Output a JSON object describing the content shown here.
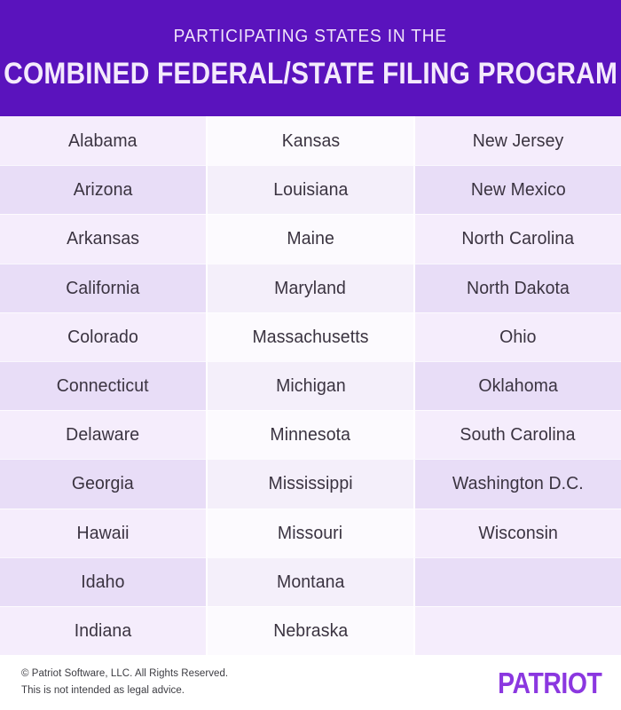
{
  "header": {
    "subtitle": "PARTICIPATING STATES IN THE",
    "title": "COMBINED FEDERAL/STATE FILING PROGRAM",
    "background_color": "#5A13BD",
    "text_color": "#F4EAFC"
  },
  "table": {
    "columns": 3,
    "rows": [
      {
        "col1": "Alabama",
        "col2": "Kansas",
        "col3": "New Jersey"
      },
      {
        "col1": "Arizona",
        "col2": "Louisiana",
        "col3": "New Mexico"
      },
      {
        "col1": "Arkansas",
        "col2": "Maine",
        "col3": "North Carolina"
      },
      {
        "col1": "California",
        "col2": "Maryland",
        "col3": "North Dakota"
      },
      {
        "col1": "Colorado",
        "col2": "Massachusetts",
        "col3": "Ohio"
      },
      {
        "col1": "Connecticut",
        "col2": "Michigan",
        "col3": "Oklahoma"
      },
      {
        "col1": "Delaware",
        "col2": "Minnesota",
        "col3": "South Carolina"
      },
      {
        "col1": "Georgia",
        "col2": "Mississippi",
        "col3": "Washington D.C."
      },
      {
        "col1": "Hawaii",
        "col2": "Missouri",
        "col3": "Wisconsin"
      },
      {
        "col1": "Idaho",
        "col2": "Montana",
        "col3": ""
      },
      {
        "col1": "Indiana",
        "col2": "Nebraska",
        "col3": ""
      }
    ],
    "cell_text_color": "#3A3340",
    "row_color_odd": "#F5EDFC",
    "row_color_even": "#E8DDF7",
    "middle_column_color_odd": "#FCFAFE",
    "middle_column_color_even": "#F4EFFA"
  },
  "footer": {
    "copyright": "© Patriot Software, LLC. All Rights Reserved.",
    "disclaimer": "This is not intended as legal advice.",
    "brand": "PATRIOT",
    "brand_color": "#8B37E0"
  }
}
